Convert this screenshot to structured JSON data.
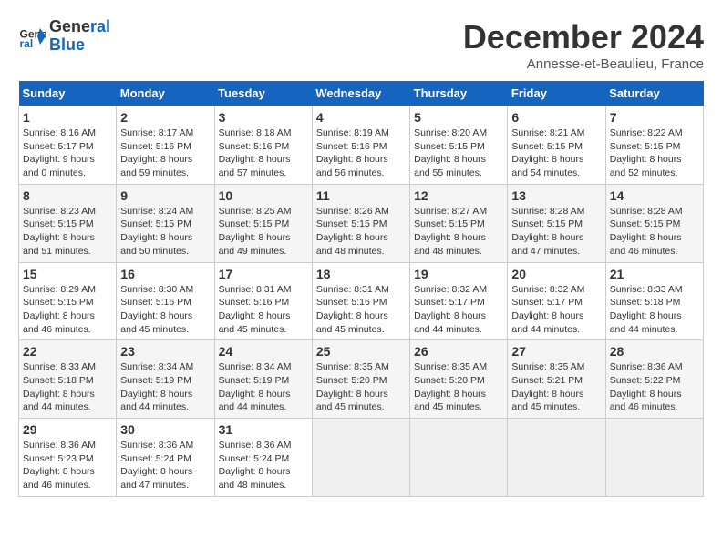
{
  "logo": {
    "line1": "General",
    "line2": "Blue"
  },
  "title": "December 2024",
  "subtitle": "Annesse-et-Beaulieu, France",
  "days_of_week": [
    "Sunday",
    "Monday",
    "Tuesday",
    "Wednesday",
    "Thursday",
    "Friday",
    "Saturday"
  ],
  "weeks": [
    [
      {
        "day": "1",
        "info": "Sunrise: 8:16 AM\nSunset: 5:17 PM\nDaylight: 9 hours\nand 0 minutes."
      },
      {
        "day": "2",
        "info": "Sunrise: 8:17 AM\nSunset: 5:16 PM\nDaylight: 8 hours\nand 59 minutes."
      },
      {
        "day": "3",
        "info": "Sunrise: 8:18 AM\nSunset: 5:16 PM\nDaylight: 8 hours\nand 57 minutes."
      },
      {
        "day": "4",
        "info": "Sunrise: 8:19 AM\nSunset: 5:16 PM\nDaylight: 8 hours\nand 56 minutes."
      },
      {
        "day": "5",
        "info": "Sunrise: 8:20 AM\nSunset: 5:15 PM\nDaylight: 8 hours\nand 55 minutes."
      },
      {
        "day": "6",
        "info": "Sunrise: 8:21 AM\nSunset: 5:15 PM\nDaylight: 8 hours\nand 54 minutes."
      },
      {
        "day": "7",
        "info": "Sunrise: 8:22 AM\nSunset: 5:15 PM\nDaylight: 8 hours\nand 52 minutes."
      }
    ],
    [
      {
        "day": "8",
        "info": "Sunrise: 8:23 AM\nSunset: 5:15 PM\nDaylight: 8 hours\nand 51 minutes."
      },
      {
        "day": "9",
        "info": "Sunrise: 8:24 AM\nSunset: 5:15 PM\nDaylight: 8 hours\nand 50 minutes."
      },
      {
        "day": "10",
        "info": "Sunrise: 8:25 AM\nSunset: 5:15 PM\nDaylight: 8 hours\nand 49 minutes."
      },
      {
        "day": "11",
        "info": "Sunrise: 8:26 AM\nSunset: 5:15 PM\nDaylight: 8 hours\nand 48 minutes."
      },
      {
        "day": "12",
        "info": "Sunrise: 8:27 AM\nSunset: 5:15 PM\nDaylight: 8 hours\nand 48 minutes."
      },
      {
        "day": "13",
        "info": "Sunrise: 8:28 AM\nSunset: 5:15 PM\nDaylight: 8 hours\nand 47 minutes."
      },
      {
        "day": "14",
        "info": "Sunrise: 8:28 AM\nSunset: 5:15 PM\nDaylight: 8 hours\nand 46 minutes."
      }
    ],
    [
      {
        "day": "15",
        "info": "Sunrise: 8:29 AM\nSunset: 5:15 PM\nDaylight: 8 hours\nand 46 minutes."
      },
      {
        "day": "16",
        "info": "Sunrise: 8:30 AM\nSunset: 5:16 PM\nDaylight: 8 hours\nand 45 minutes."
      },
      {
        "day": "17",
        "info": "Sunrise: 8:31 AM\nSunset: 5:16 PM\nDaylight: 8 hours\nand 45 minutes."
      },
      {
        "day": "18",
        "info": "Sunrise: 8:31 AM\nSunset: 5:16 PM\nDaylight: 8 hours\nand 45 minutes."
      },
      {
        "day": "19",
        "info": "Sunrise: 8:32 AM\nSunset: 5:17 PM\nDaylight: 8 hours\nand 44 minutes."
      },
      {
        "day": "20",
        "info": "Sunrise: 8:32 AM\nSunset: 5:17 PM\nDaylight: 8 hours\nand 44 minutes."
      },
      {
        "day": "21",
        "info": "Sunrise: 8:33 AM\nSunset: 5:18 PM\nDaylight: 8 hours\nand 44 minutes."
      }
    ],
    [
      {
        "day": "22",
        "info": "Sunrise: 8:33 AM\nSunset: 5:18 PM\nDaylight: 8 hours\nand 44 minutes."
      },
      {
        "day": "23",
        "info": "Sunrise: 8:34 AM\nSunset: 5:19 PM\nDaylight: 8 hours\nand 44 minutes."
      },
      {
        "day": "24",
        "info": "Sunrise: 8:34 AM\nSunset: 5:19 PM\nDaylight: 8 hours\nand 44 minutes."
      },
      {
        "day": "25",
        "info": "Sunrise: 8:35 AM\nSunset: 5:20 PM\nDaylight: 8 hours\nand 45 minutes."
      },
      {
        "day": "26",
        "info": "Sunrise: 8:35 AM\nSunset: 5:20 PM\nDaylight: 8 hours\nand 45 minutes."
      },
      {
        "day": "27",
        "info": "Sunrise: 8:35 AM\nSunset: 5:21 PM\nDaylight: 8 hours\nand 45 minutes."
      },
      {
        "day": "28",
        "info": "Sunrise: 8:36 AM\nSunset: 5:22 PM\nDaylight: 8 hours\nand 46 minutes."
      }
    ],
    [
      {
        "day": "29",
        "info": "Sunrise: 8:36 AM\nSunset: 5:23 PM\nDaylight: 8 hours\nand 46 minutes."
      },
      {
        "day": "30",
        "info": "Sunrise: 8:36 AM\nSunset: 5:24 PM\nDaylight: 8 hours\nand 47 minutes."
      },
      {
        "day": "31",
        "info": "Sunrise: 8:36 AM\nSunset: 5:24 PM\nDaylight: 8 hours\nand 48 minutes."
      },
      null,
      null,
      null,
      null
    ]
  ]
}
